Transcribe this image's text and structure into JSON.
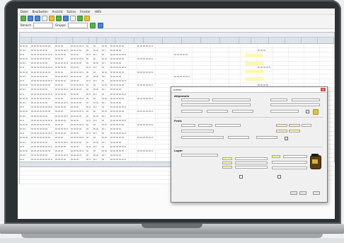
{
  "window": {
    "menus": [
      "Datei",
      "Bearbeiten",
      "Ansicht",
      "Extras",
      "Fenster",
      "Hilfe"
    ],
    "filter_label_1": "Bereich",
    "filter_label_2": "Gruppe",
    "filter_value_1": "Alle",
    "filter_value_2": "Kategorie"
  },
  "dialog": {
    "title": "Artikel",
    "section_1": "Allgemein",
    "section_2": "Preis",
    "section_3": "Lager",
    "close_glyph": "x"
  },
  "colors": {
    "accent_blue": "#1a67c8",
    "highlight_yellow": "#fff4a6"
  },
  "icons": [
    "new-icon",
    "open-icon",
    "save-icon",
    "print-icon",
    "search-icon",
    "filter-icon",
    "refresh-icon",
    "export-icon"
  ]
}
